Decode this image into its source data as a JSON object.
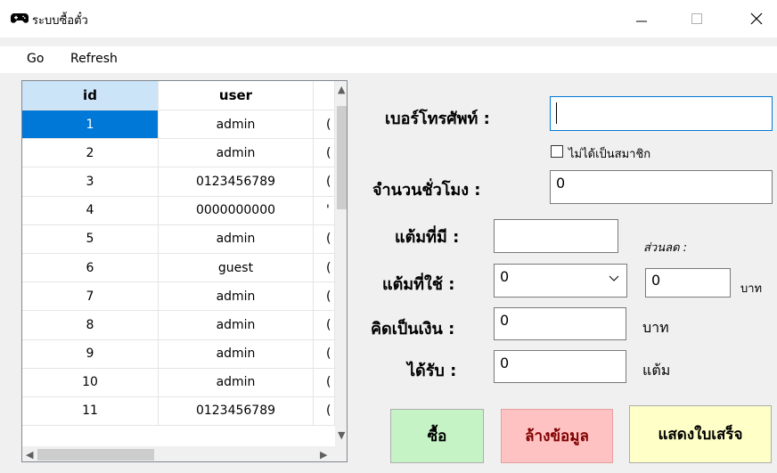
{
  "window": {
    "title": "ระบบซื้อตั๋ว",
    "icon": "gamepad-icon"
  },
  "menu": {
    "items": [
      "Go",
      "Refresh"
    ]
  },
  "grid": {
    "columns": [
      "id",
      "user",
      ""
    ],
    "rows": [
      {
        "id": "1",
        "user": "admin",
        "extra": "("
      },
      {
        "id": "2",
        "user": "admin",
        "extra": "("
      },
      {
        "id": "3",
        "user": "0123456789",
        "extra": "("
      },
      {
        "id": "4",
        "user": "0000000000",
        "extra": "'"
      },
      {
        "id": "5",
        "user": "admin",
        "extra": "("
      },
      {
        "id": "6",
        "user": "guest",
        "extra": "("
      },
      {
        "id": "7",
        "user": "admin",
        "extra": "("
      },
      {
        "id": "8",
        "user": "admin",
        "extra": "("
      },
      {
        "id": "9",
        "user": "admin",
        "extra": "("
      },
      {
        "id": "10",
        "user": "admin",
        "extra": "("
      },
      {
        "id": "11",
        "user": "0123456789",
        "extra": "("
      }
    ],
    "selected_row": 0
  },
  "form": {
    "phone_label": "เบอร์โทรศัพท์ :",
    "phone_value": "",
    "not_member_label": "ไม่ได้เป็นสมาชิก",
    "hours_label": "จำนวนชั่วโมง :",
    "hours_value": "0",
    "points_have_label": "แต้มที่มี :",
    "points_have_value": "",
    "discount_label": "ส่วนลด :",
    "points_use_label": "แต้มที่ใช้ :",
    "points_use_value": "0",
    "discount_value": "0",
    "discount_unit": "บาท",
    "total_label": "คิดเป็นเงิน :",
    "total_value": "0",
    "total_unit": "บาท",
    "earn_label": "ได้รับ :",
    "earn_value": "0",
    "earn_unit": "แต้ม"
  },
  "buttons": {
    "buy": "ซื้อ",
    "clear": "ล้างข้อมูล",
    "receipt": "แสดงใบเสร็จ"
  },
  "colors": {
    "selected": "#0078d7",
    "buy_bg": "#c6f3c6",
    "clear_bg": "#ffc2c2",
    "receipt_bg": "#ffffc8"
  }
}
